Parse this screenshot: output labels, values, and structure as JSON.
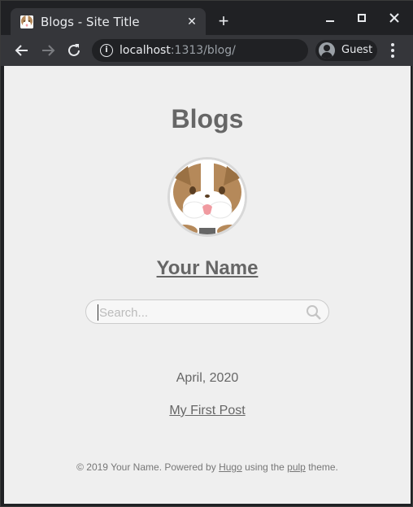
{
  "browser": {
    "tab": {
      "title": "Blogs - Site Title",
      "favicon": "bulldog-favicon"
    },
    "new_tab_label": "+",
    "window_controls": {
      "minimize": "–",
      "maximize": "□",
      "close": "✕"
    },
    "nav": {
      "back": "←",
      "forward": "→",
      "reload": "↻"
    },
    "url": {
      "host": "localhost",
      "rest": ":1313/blog/"
    },
    "profile": {
      "label": "Guest"
    }
  },
  "page": {
    "title": "Blogs",
    "author": "Your Name",
    "search": {
      "placeholder": "Search...",
      "value": ""
    },
    "sections": [
      {
        "month": "April, 2020",
        "posts": [
          {
            "title": "My First Post"
          }
        ]
      }
    ],
    "footer": {
      "prefix": "© 2019 Your Name. Powered by",
      "hugo_link": "Hugo",
      "middle": "using the",
      "theme_link": "pulp",
      "suffix": "theme."
    }
  }
}
